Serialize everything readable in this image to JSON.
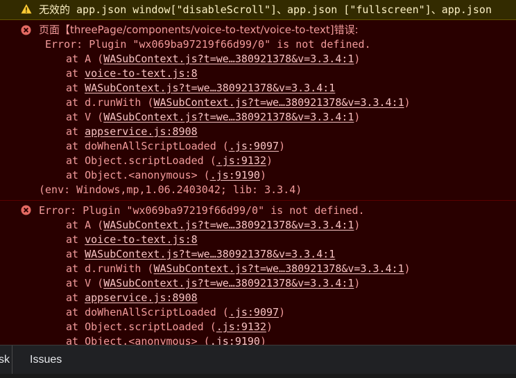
{
  "warning": {
    "icon": "warning-triangle-icon",
    "text": "无效的 app.json window[\"disableScroll\"]、app.json [\"fullscreen\"]、app.json"
  },
  "error_blocks": [
    {
      "icon": "error-circle-icon",
      "header": "页面【threePage/components/voice-to-text/voice-to-text]错误:",
      "message": "Error: Plugin \"wx069ba97219f66d99/0\" is not defined.",
      "stack": [
        {
          "prefix": "at A (",
          "link": "WASubContext.js?t=we…380921378&v=3.3.4:1",
          "suffix": ")"
        },
        {
          "prefix": "at ",
          "link": "voice-to-text.js:8",
          "suffix": ""
        },
        {
          "prefix": "at ",
          "link": "WASubContext.js?t=we…380921378&v=3.3.4:1",
          "suffix": ""
        },
        {
          "prefix": "at d.runWith (",
          "link": "WASubContext.js?t=we…380921378&v=3.3.4:1",
          "suffix": ")"
        },
        {
          "prefix": "at V (",
          "link": "WASubContext.js?t=we…380921378&v=3.3.4:1",
          "suffix": ")"
        },
        {
          "prefix": "at ",
          "link": "appservice.js:8908",
          "suffix": ""
        },
        {
          "prefix": "at doWhenAllScriptLoaded (",
          "link": ".js:9097",
          "suffix": ")"
        },
        {
          "prefix": "at Object.scriptLoaded (",
          "link": ".js:9132",
          "suffix": ")"
        },
        {
          "prefix": "at Object.<anonymous> (",
          "link": ".js:9190",
          "suffix": ")"
        }
      ],
      "env": "(env: Windows,mp,1.06.2403042; lib: 3.3.4)"
    },
    {
      "icon": "error-circle-icon",
      "message": "Error: Plugin \"wx069ba97219f66d99/0\" is not defined.",
      "stack": [
        {
          "prefix": "at A (",
          "link": "WASubContext.js?t=we…380921378&v=3.3.4:1",
          "suffix": ")"
        },
        {
          "prefix": "at ",
          "link": "voice-to-text.js:8",
          "suffix": ""
        },
        {
          "prefix": "at ",
          "link": "WASubContext.js?t=we…380921378&v=3.3.4:1",
          "suffix": ""
        },
        {
          "prefix": "at d.runWith (",
          "link": "WASubContext.js?t=we…380921378&v=3.3.4:1",
          "suffix": ")"
        },
        {
          "prefix": "at V (",
          "link": "WASubContext.js?t=we…380921378&v=3.3.4:1",
          "suffix": ")"
        },
        {
          "prefix": "at ",
          "link": "appservice.js:8908",
          "suffix": ""
        },
        {
          "prefix": "at doWhenAllScriptLoaded (",
          "link": ".js:9097",
          "suffix": ")"
        },
        {
          "prefix": "at Object.scriptLoaded (",
          "link": ".js:9132",
          "suffix": ")"
        },
        {
          "prefix": "at Object.<anonymous> (",
          "link": ".js:9190",
          "suffix": ")"
        }
      ]
    }
  ],
  "drawer_tabs": [
    {
      "label": "sk"
    },
    {
      "label": "Issues"
    }
  ],
  "colors": {
    "error_background": "#290000",
    "error_text": "#f29b9b",
    "error_icon": "#e46962",
    "warning_background": "#332b00",
    "warning_text": "#fcf0c4",
    "warning_icon": "#fcc934",
    "drawer_background": "#202124"
  }
}
